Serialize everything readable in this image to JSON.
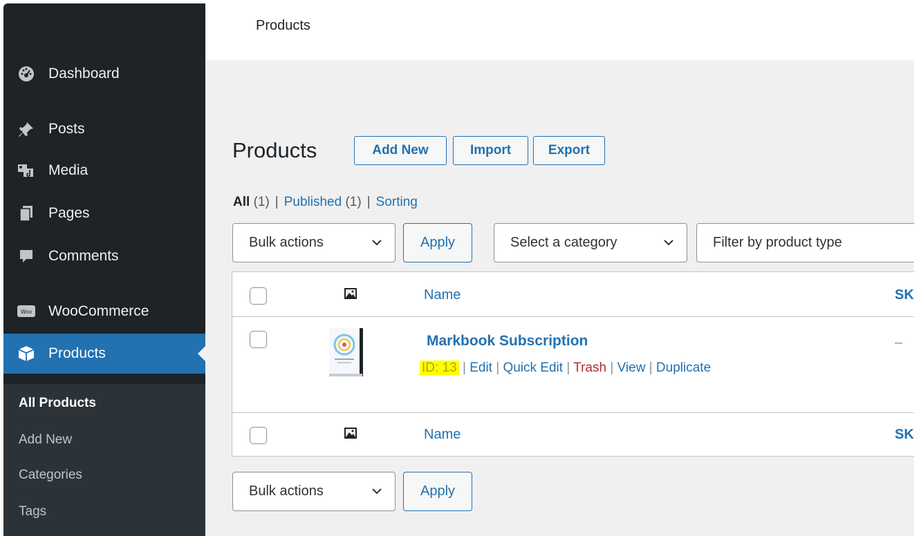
{
  "topbar": {
    "title": "Products"
  },
  "sidebar": {
    "items": [
      {
        "label": "Dashboard",
        "icon": "dashboard-icon"
      },
      {
        "label": "Posts",
        "icon": "pin-icon"
      },
      {
        "label": "Media",
        "icon": "media-icon"
      },
      {
        "label": "Pages",
        "icon": "pages-icon"
      },
      {
        "label": "Comments",
        "icon": "comment-icon"
      },
      {
        "label": "WooCommerce",
        "icon": "woo-icon"
      },
      {
        "label": "Products",
        "icon": "box-icon",
        "active": true
      }
    ],
    "submenu": [
      "All Products",
      "Add New",
      "Categories",
      "Tags"
    ]
  },
  "main": {
    "heading": "Products",
    "buttons": {
      "add_new": "Add New",
      "import": "Import",
      "export": "Export"
    },
    "views": {
      "all": "All",
      "all_count": "(1)",
      "published": "Published",
      "published_count": "(1)",
      "sorting": "Sorting",
      "separator": "|"
    },
    "filters": {
      "bulk_actions": "Bulk actions",
      "apply": "Apply",
      "category": "Select a category",
      "product_type": "Filter by product type"
    },
    "table": {
      "columns": {
        "name": "Name",
        "sku": "SK"
      },
      "rows": [
        {
          "name": "Markbook Subscription",
          "sku": "–",
          "actions": {
            "id": "ID: 13",
            "edit": "Edit",
            "quick_edit": "Quick Edit",
            "trash": "Trash",
            "view": "View",
            "duplicate": "Duplicate"
          }
        }
      ]
    }
  },
  "colors": {
    "accent": "#2271b1",
    "sidebar": "#1d2327",
    "submenu": "#2c3338",
    "trash": "#b32d2e",
    "highlight": "#ffff00"
  }
}
